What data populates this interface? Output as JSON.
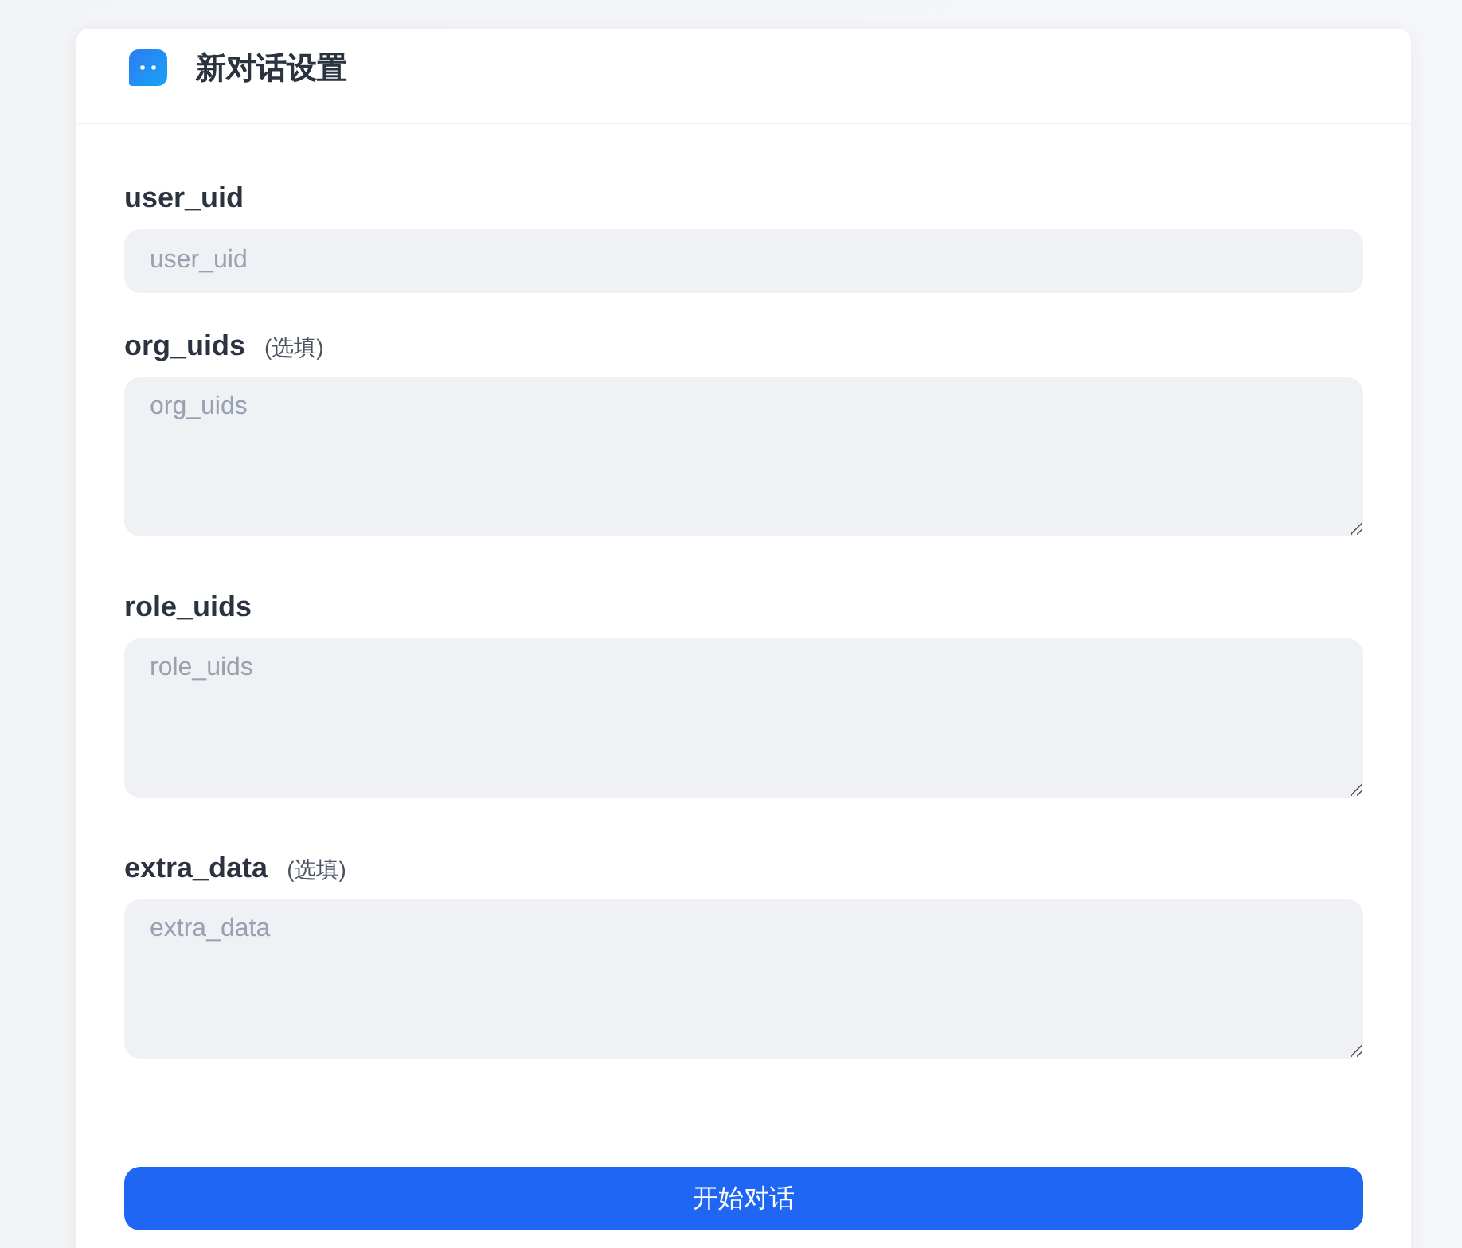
{
  "header": {
    "title": "新对话设置"
  },
  "fields": [
    {
      "kind": "input",
      "label": "user_uid",
      "placeholder": "user_uid"
    },
    {
      "kind": "textarea",
      "label": "org_uids",
      "hint": "(选填)",
      "placeholder": "org_uids"
    },
    {
      "kind": "textarea",
      "label": "role_uids",
      "placeholder": "role_uids"
    },
    {
      "kind": "textarea",
      "label": "extra_data",
      "hint": "(选填)",
      "placeholder": "extra_data"
    }
  ],
  "submit_button": {
    "label": "开始对话"
  }
}
